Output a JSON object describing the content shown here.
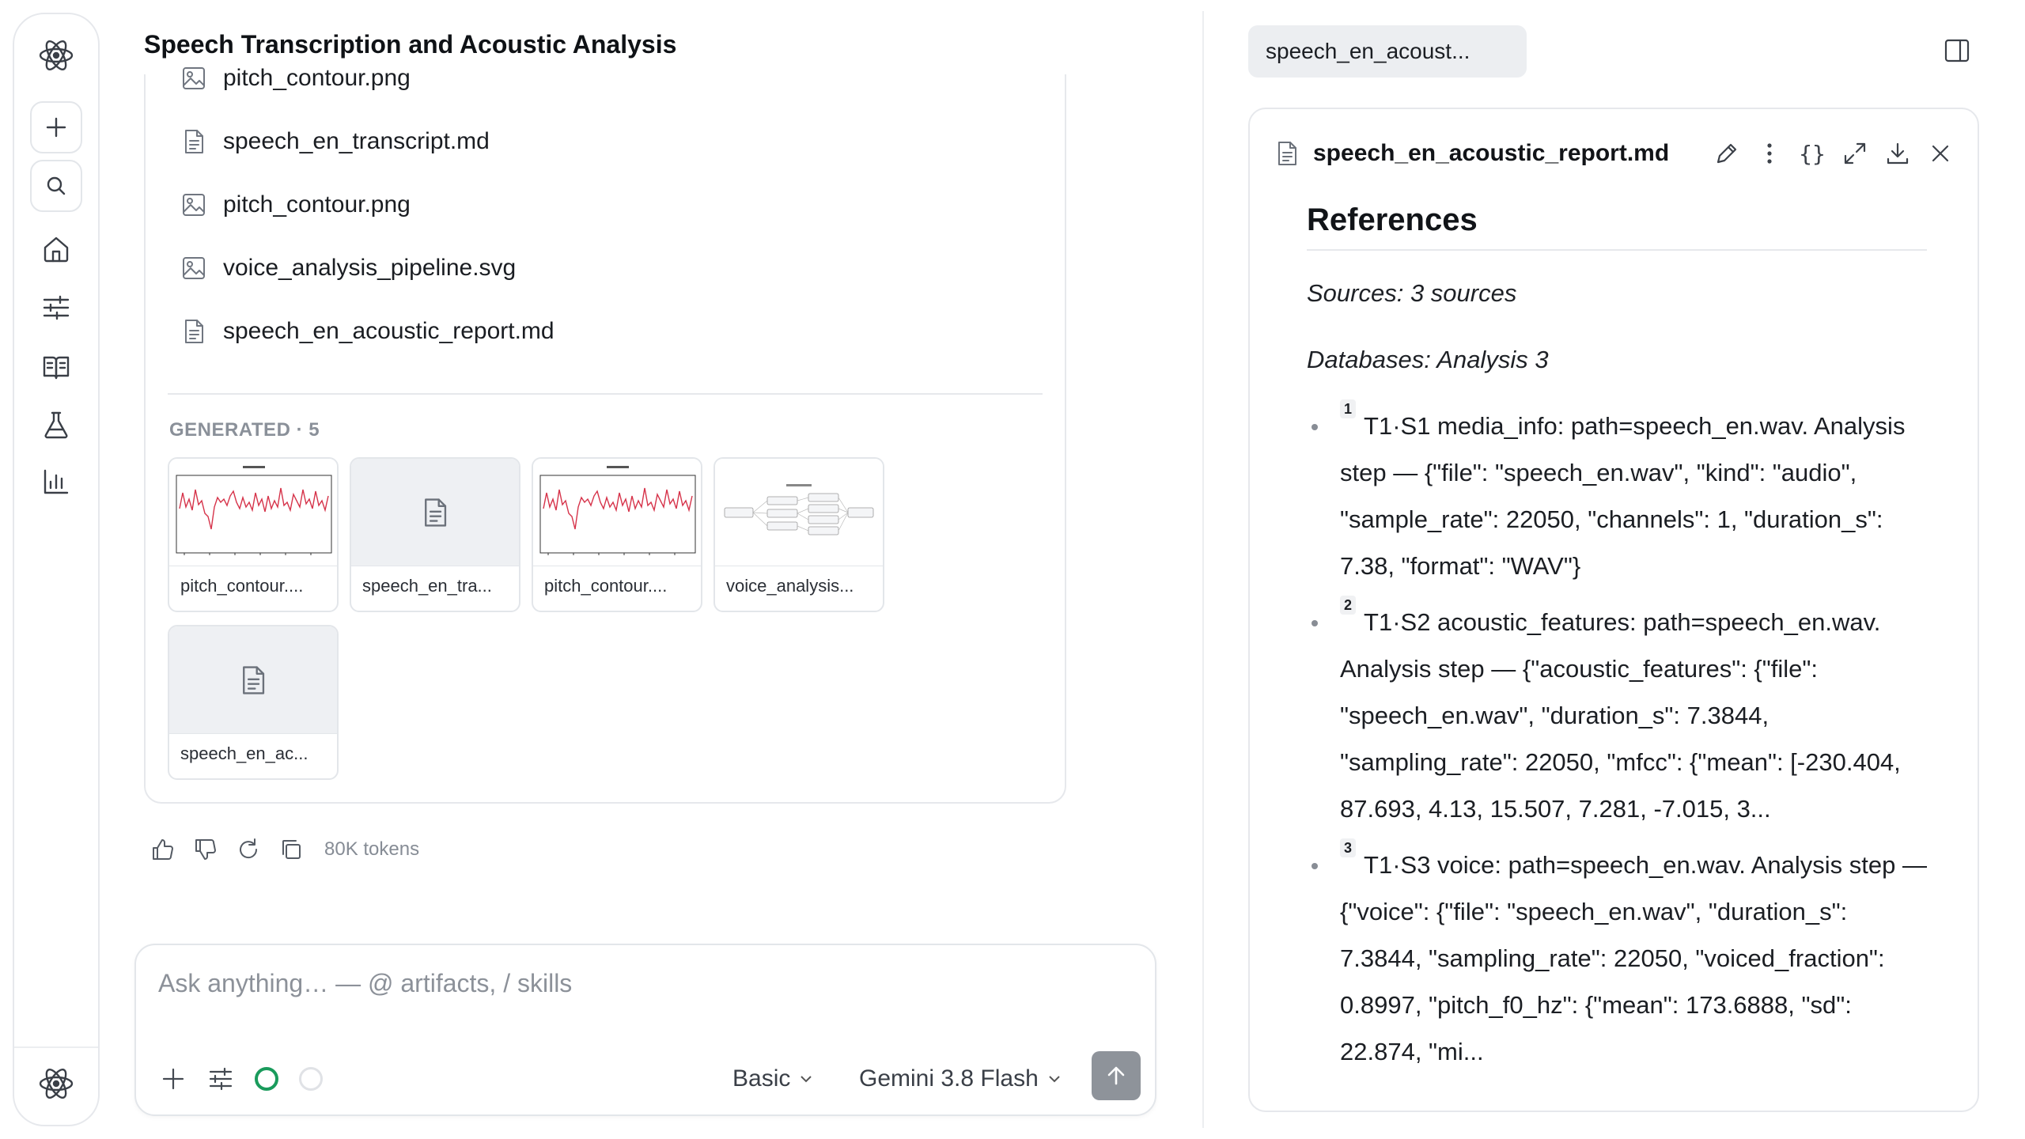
{
  "chat": {
    "title": "Speech Transcription and Acoustic Analysis",
    "files": [
      {
        "name": "pitch_contour.png",
        "kind": "image"
      },
      {
        "name": "speech_en_transcript.md",
        "kind": "doc"
      },
      {
        "name": "pitch_contour.png",
        "kind": "image"
      },
      {
        "name": "voice_analysis_pipeline.svg",
        "kind": "image"
      },
      {
        "name": "speech_en_acoustic_report.md",
        "kind": "doc"
      }
    ],
    "generated_label": "GENERATED · 5",
    "thumbnails": [
      {
        "caption": "pitch_contour....",
        "preview": "pitch-chart"
      },
      {
        "caption": "speech_en_tra...",
        "preview": "doc-icon"
      },
      {
        "caption": "pitch_contour....",
        "preview": "pitch-chart"
      },
      {
        "caption": "voice_analysis...",
        "preview": "pipeline-diagram"
      },
      {
        "caption": "speech_en_ac...",
        "preview": "doc-icon"
      }
    ],
    "tokens": "80K tokens"
  },
  "composer": {
    "placeholder": "Ask anything… — @ artifacts, / skills",
    "mode": "Basic",
    "model": "Gemini 3.8 Flash"
  },
  "panel": {
    "tab": "speech_en_acoust...",
    "filename": "speech_en_acoustic_report.md",
    "heading": "References",
    "sources": "Sources: 3 sources",
    "databases": "Databases: Analysis 3",
    "refs": [
      {
        "n": "1",
        "text": "T1·S1 media_info: path=speech_en.wav. Analysis step — {\"file\": \"speech_en.wav\", \"kind\": \"audio\", \"sample_rate\": 22050, \"channels\": 1, \"duration_s\": 7.38, \"format\": \"WAV\"}"
      },
      {
        "n": "2",
        "text": "T1·S2 acoustic_features: path=speech_en.wav. Analysis step — {\"acoustic_features\": {\"file\": \"speech_en.wav\", \"duration_s\": 7.3844, \"sampling_rate\": 22050, \"mfcc\": {\"mean\": [-230.404, 87.693, 4.13, 15.507, 7.281, -7.015, 3..."
      },
      {
        "n": "3",
        "text": "T1·S3 voice: path=speech_en.wav. Analysis step — {\"voice\": {\"file\": \"speech_en.wav\", \"duration_s\": 7.3844, \"sampling_rate\": 22050, \"voiced_fraction\": 0.8997, \"pitch_f0_hz\": {\"mean\": 173.6888, \"sd\": 22.874, \"mi..."
      }
    ]
  },
  "colors": {
    "accent_green": "#1a9b5c",
    "send_button": "#8e939a",
    "pitch_line": "#d6334a"
  }
}
